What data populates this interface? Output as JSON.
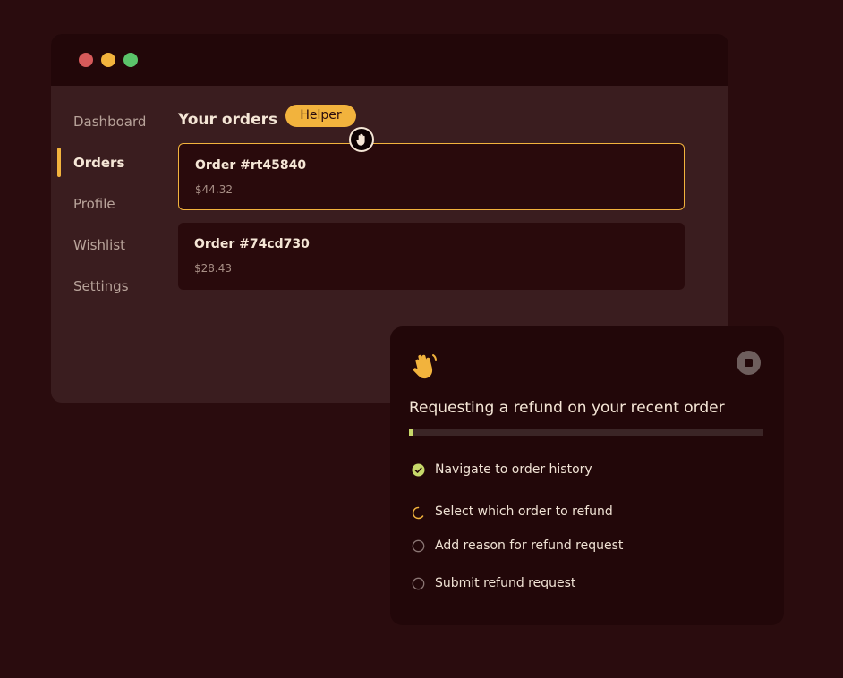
{
  "window": {
    "traffic_lights": [
      "#d65a5a",
      "#f2b33d",
      "#5bc46a"
    ]
  },
  "sidebar": {
    "items": [
      {
        "label": "Dashboard"
      },
      {
        "label": "Orders"
      },
      {
        "label": "Profile"
      },
      {
        "label": "Wishlist"
      },
      {
        "label": "Settings"
      }
    ],
    "active_index": 1
  },
  "orders": {
    "title": "Your orders",
    "items": [
      {
        "id": "Order #rt45840",
        "price": "$44.32",
        "selected": true
      },
      {
        "id": "Order #74cd730",
        "price": "$28.43",
        "selected": false
      }
    ]
  },
  "helper": {
    "badge_label": "Helper",
    "cursor_icon": "hand-icon"
  },
  "task_panel": {
    "icon": "waving-hand-icon",
    "stop_icon": "stop-icon",
    "title": "Requesting a refund on your recent order",
    "progress_percent": 1,
    "steps": [
      {
        "label": "Navigate to order history",
        "status": "done"
      },
      {
        "label": "Select which order to refund",
        "status": "in-progress"
      },
      {
        "label": "Add reason for refund request",
        "status": "pending"
      },
      {
        "label": "Submit refund request",
        "status": "pending"
      }
    ]
  },
  "colors": {
    "background": "#2a0c0e",
    "accent": "#f2b33d",
    "done_green": "#c7d86a",
    "text": "#f5e6d6",
    "muted_text": "#b8a39a"
  }
}
